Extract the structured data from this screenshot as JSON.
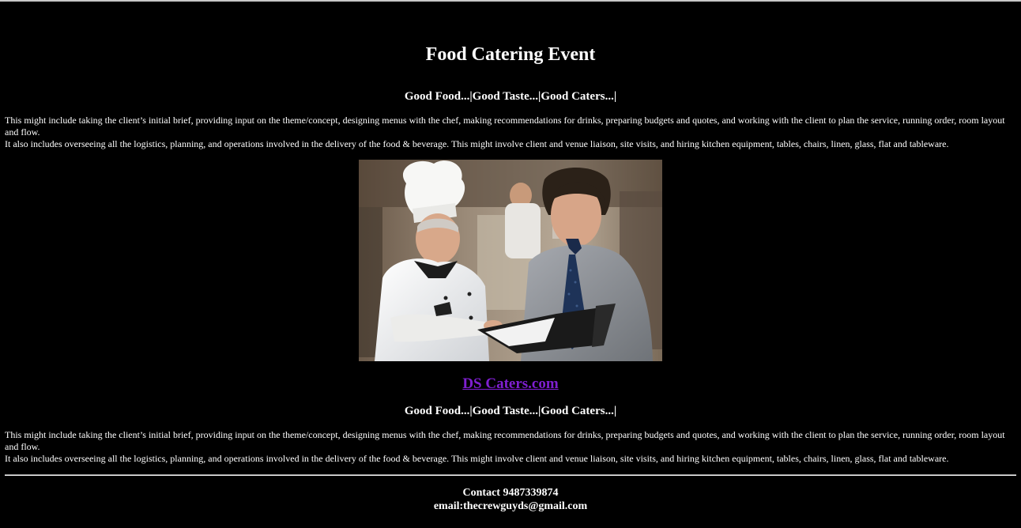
{
  "page": {
    "title": "Food Catering Event",
    "tagline": "Good Food...|Good Taste...|Good Caters...|",
    "paragraphs": [
      "This might include taking the client’s initial brief, providing input on the theme/concept, designing menus with the chef, making recommendations for drinks, preparing budgets and quotes, and working with the client to plan the service, running order, room layout and flow.",
      "It also includes overseeing all the logistics, planning, and operations involved in the delivery of the food & beverage. This might involve client and venue liaison, site visits, and hiring kitchen equipment, tables, chairs, linen, glass, flat and tableware."
    ],
    "image_alt": "Chef in white uniform reviewing a menu folder with a man in a grey shirt and tie in a restaurant kitchen",
    "link_label": "DS Caters.com",
    "contact_phone": "Contact 9487339874",
    "contact_email": "email:thecrewguyds@gmail.com"
  },
  "colors": {
    "background": "#000000",
    "text": "#ffffff",
    "link": "#7f1fd1"
  }
}
